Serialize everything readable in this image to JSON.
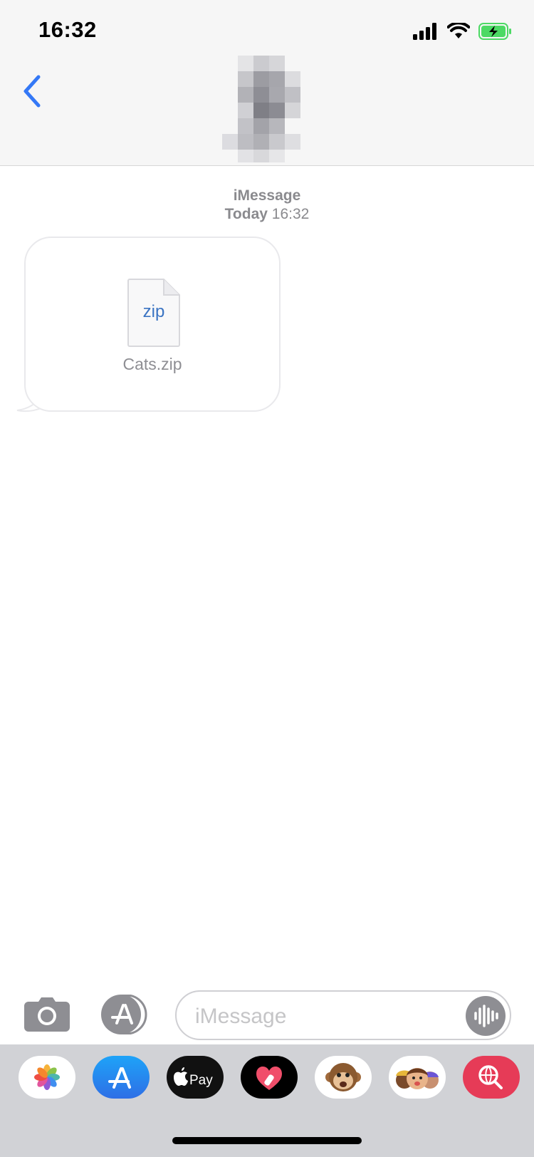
{
  "status_bar": {
    "time": "16:32",
    "icons": [
      "cellular-signal-icon",
      "wifi-icon",
      "battery-charging-icon"
    ]
  },
  "header": {
    "back_icon": "chevron-left-icon",
    "contact_avatar": "pixelated-avatar"
  },
  "conversation": {
    "service_label": "iMessage",
    "day_label": "Today",
    "time_label": "16:32",
    "messages": [
      {
        "type": "attachment",
        "file_extension": "zip",
        "file_name": "Cats.zip"
      }
    ]
  },
  "composer": {
    "camera_icon": "camera-icon",
    "apps_icon": "app-store-icon",
    "placeholder": "iMessage",
    "audio_icon": "waveform-icon"
  },
  "app_drawer": {
    "apps": [
      {
        "name": "photos-app-icon"
      },
      {
        "name": "app-store-app-icon"
      },
      {
        "name": "apple-pay-app-icon",
        "label": "Pay"
      },
      {
        "name": "digital-touch-app-icon"
      },
      {
        "name": "animoji-app-icon"
      },
      {
        "name": "memoji-app-icon"
      },
      {
        "name": "web-images-search-app-icon"
      }
    ]
  },
  "colors": {
    "accent": "#3478f6",
    "header_bg": "#f6f6f6",
    "drawer_bg": "#d1d2d6",
    "meta_text": "#8a8a8e"
  }
}
